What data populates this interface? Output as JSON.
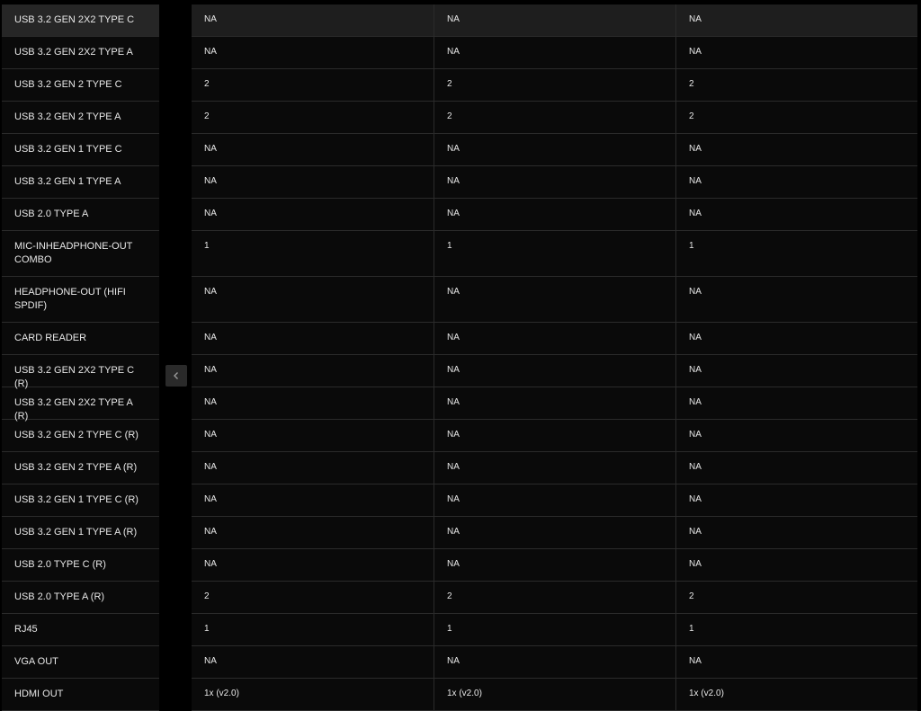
{
  "rows": [
    {
      "label": "USB 3.2 GEN 2X2 TYPE C",
      "values": [
        "NA",
        "NA",
        "NA"
      ]
    },
    {
      "label": "USB 3.2 GEN 2X2 TYPE A",
      "values": [
        "NA",
        "NA",
        "NA"
      ]
    },
    {
      "label": "USB 3.2 GEN 2 TYPE C",
      "values": [
        "2",
        "2",
        "2"
      ]
    },
    {
      "label": "USB 3.2 GEN 2 TYPE A",
      "values": [
        "2",
        "2",
        "2"
      ]
    },
    {
      "label": "USB 3.2 GEN 1 TYPE C",
      "values": [
        "NA",
        "NA",
        "NA"
      ]
    },
    {
      "label": "USB 3.2 GEN 1 TYPE A",
      "values": [
        "NA",
        "NA",
        "NA"
      ]
    },
    {
      "label": "USB 2.0 TYPE A",
      "values": [
        "NA",
        "NA",
        "NA"
      ]
    },
    {
      "label": "MIC-INHEADPHONE-OUT COMBO",
      "values": [
        "1",
        "1",
        "1"
      ]
    },
    {
      "label": "HEADPHONE-OUT (HIFI SPDIF)",
      "values": [
        "NA",
        "NA",
        "NA"
      ]
    },
    {
      "label": "CARD READER",
      "values": [
        "NA",
        "NA",
        "NA"
      ]
    },
    {
      "label": "USB 3.2 GEN 2X2 TYPE C (R)",
      "values": [
        "NA",
        "NA",
        "NA"
      ]
    },
    {
      "label": "USB 3.2 GEN 2X2 TYPE A (R)",
      "values": [
        "NA",
        "NA",
        "NA"
      ]
    },
    {
      "label": "USB 3.2 GEN 2 TYPE C (R)",
      "values": [
        "NA",
        "NA",
        "NA"
      ]
    },
    {
      "label": "USB 3.2 GEN 2 TYPE A (R)",
      "values": [
        "NA",
        "NA",
        "NA"
      ]
    },
    {
      "label": "USB 3.2 GEN 1 TYPE C (R)",
      "values": [
        "NA",
        "NA",
        "NA"
      ]
    },
    {
      "label": "USB 3.2 GEN 1 TYPE A (R)",
      "values": [
        "NA",
        "NA",
        "NA"
      ]
    },
    {
      "label": "USB 2.0 TYPE C (R)",
      "values": [
        "NA",
        "NA",
        "NA"
      ]
    },
    {
      "label": "USB 2.0 TYPE A (R)",
      "values": [
        "2",
        "2",
        "2"
      ]
    },
    {
      "label": "RJ45",
      "values": [
        "1",
        "1",
        "1"
      ]
    },
    {
      "label": "VGA OUT",
      "values": [
        "NA",
        "NA",
        "NA"
      ]
    },
    {
      "label": "HDMI OUT",
      "values": [
        "1x (v2.0)",
        "1x (v2.0)",
        "1x (v2.0)"
      ]
    }
  ],
  "collapse_button": {
    "icon": "chevron-left-icon"
  },
  "colors": {
    "background": "#000000",
    "row": "#0a0a0a",
    "active_row": "#262626",
    "border": "#2b2b2b",
    "text": "#e8e8e8"
  }
}
